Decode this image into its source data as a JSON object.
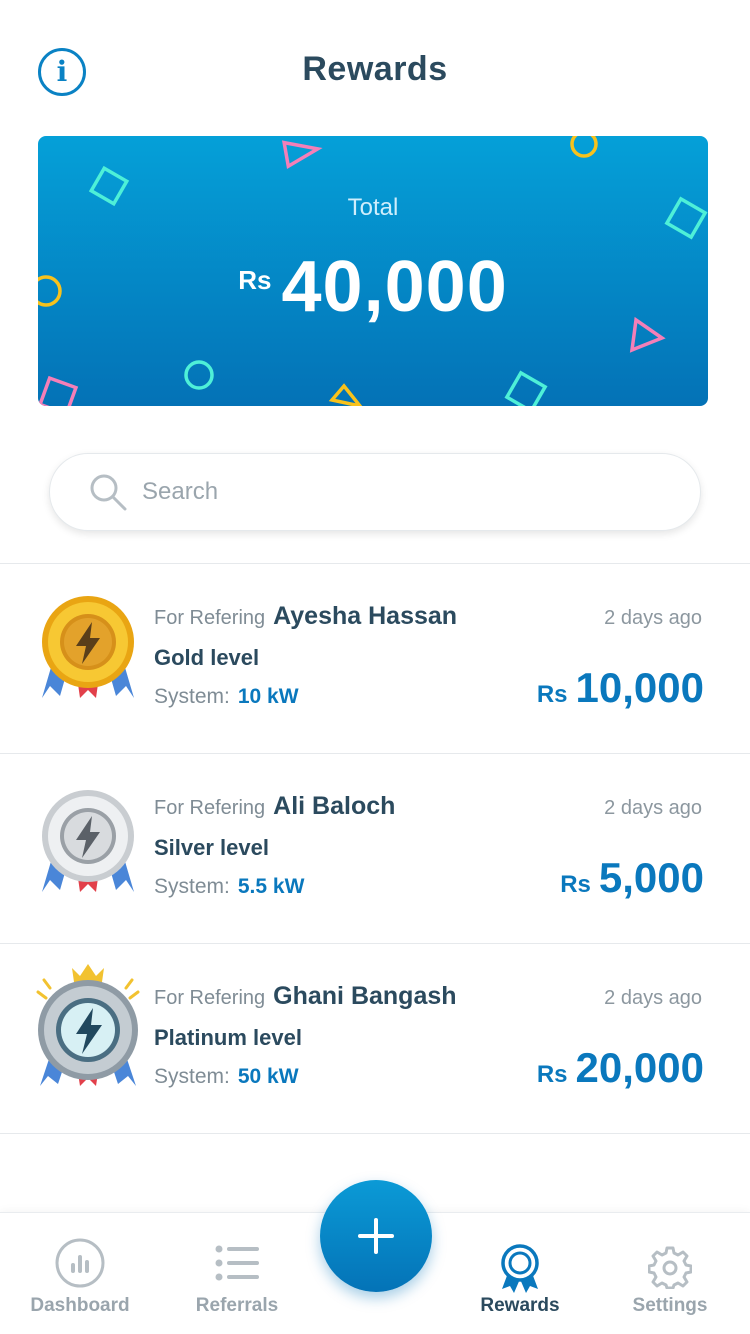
{
  "header": {
    "title": "Rewards",
    "info_icon": "info-icon",
    "info_glyph": "i"
  },
  "total": {
    "label": "Total",
    "currency": "Rs",
    "amount": "40,000"
  },
  "search": {
    "placeholder": "Search",
    "icon": "search-icon"
  },
  "rewards": [
    {
      "prefix": "For Refering",
      "name": "Ayesha Hassan",
      "level": "Gold level",
      "system_label": "System:",
      "system_value": "10 kW",
      "time": "2 days ago",
      "currency": "Rs",
      "amount": "10,000",
      "medal": "gold-medal-icon"
    },
    {
      "prefix": "For Refering",
      "name": "Ali Baloch",
      "level": "Silver level",
      "system_label": "System:",
      "system_value": "5.5 kW",
      "time": "2 days ago",
      "currency": "Rs",
      "amount": "5,000",
      "medal": "silver-medal-icon"
    },
    {
      "prefix": "For Refering",
      "name": "Ghani Bangash",
      "level": "Platinum level",
      "system_label": "System:",
      "system_value": "50 kW",
      "time": "2 days ago",
      "currency": "Rs",
      "amount": "20,000",
      "medal": "platinum-medal-icon"
    }
  ],
  "tabbar": {
    "tabs": [
      {
        "label": "Dashboard",
        "icon": "dashboard-icon",
        "active": false
      },
      {
        "label": "Referrals",
        "icon": "list-icon",
        "active": false
      },
      {
        "label": "Rewards",
        "icon": "rewards-icon",
        "active": true
      },
      {
        "label": "Settings",
        "icon": "gear-icon",
        "active": false
      }
    ],
    "fab_icon": "plus-icon"
  },
  "colors": {
    "accent": "#0a78bd",
    "card_top": "#05a0d8",
    "card_bottom": "#0472b6",
    "text_dark": "#2b4a5e",
    "text_muted": "#7f8c95"
  }
}
